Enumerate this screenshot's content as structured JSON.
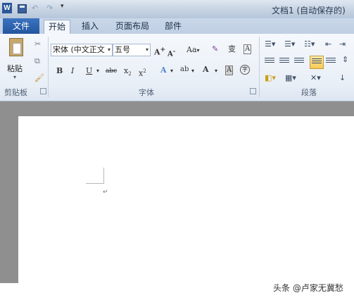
{
  "window": {
    "title": "文档1 (自动保存的)"
  },
  "quick_access": {
    "logo": "W",
    "undo_glyph": "↶",
    "redo_glyph": "↷",
    "more_glyph": "▾"
  },
  "tabs": {
    "file": "文件",
    "items": [
      "开始",
      "插入",
      "页面布局",
      "部件"
    ],
    "active_index": 0
  },
  "ribbon": {
    "clipboard": {
      "paste_label": "粘贴",
      "group_label": "剪贴板"
    },
    "font": {
      "font_name": "宋体 (中文正文",
      "font_size": "五号",
      "grow": "A",
      "shrink": "A",
      "change_case": "Aa",
      "bold": "B",
      "italic": "I",
      "underline": "U",
      "strikethrough": "abc",
      "subscript": "x",
      "superscript": "x",
      "text_effects": "A",
      "highlight": "ab",
      "font_color": "A",
      "char_shading": "A",
      "enclose": "字",
      "phonetic": "变",
      "group_label": "字体"
    },
    "paragraph": {
      "group_label": "段落"
    }
  },
  "colors": {
    "file_tab": "#2b62ac",
    "ribbon_bg": "#eef3f9",
    "highlight": "#f2f200",
    "font_color": "#e0201c",
    "active_align": "#f8c956"
  },
  "watermark": "头条 @卢家无冀愁"
}
